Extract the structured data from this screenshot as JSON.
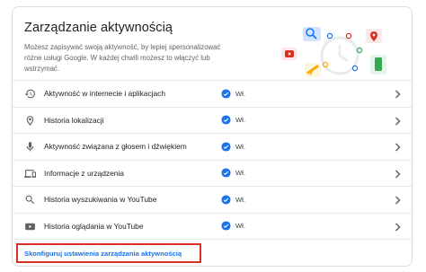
{
  "card": {
    "title": "Zarządzanie aktywnością",
    "description": "Możesz zapisywać swoją aktywność, by lepiej spersonalizować różne usługi Google. W każdej chwili możesz to włączyć lub wstrzymać."
  },
  "rows": [
    {
      "icon": "history-icon",
      "label": "Aktywność w internecie i aplikacjach",
      "status": "Wł."
    },
    {
      "icon": "location-pin-icon",
      "label": "Historia lokalizacji",
      "status": "Wł."
    },
    {
      "icon": "microphone-icon",
      "label": "Aktywność związana z głosem i dźwiękiem",
      "status": "Wł."
    },
    {
      "icon": "devices-icon",
      "label": "Informacje z urządzenia",
      "status": "Wł."
    },
    {
      "icon": "search-icon",
      "label": "Historia wyszukiwania w YouTube",
      "status": "Wł."
    },
    {
      "icon": "youtube-icon",
      "label": "Historia oglądania w YouTube",
      "status": "Wł."
    }
  ],
  "footer": {
    "cta_label": "Skonfiguruj ustawienia zarządzania aktywnością"
  },
  "colors": {
    "accent": "#1a73e8",
    "highlight_border": "#d93025",
    "divider": "#e8eaed"
  }
}
